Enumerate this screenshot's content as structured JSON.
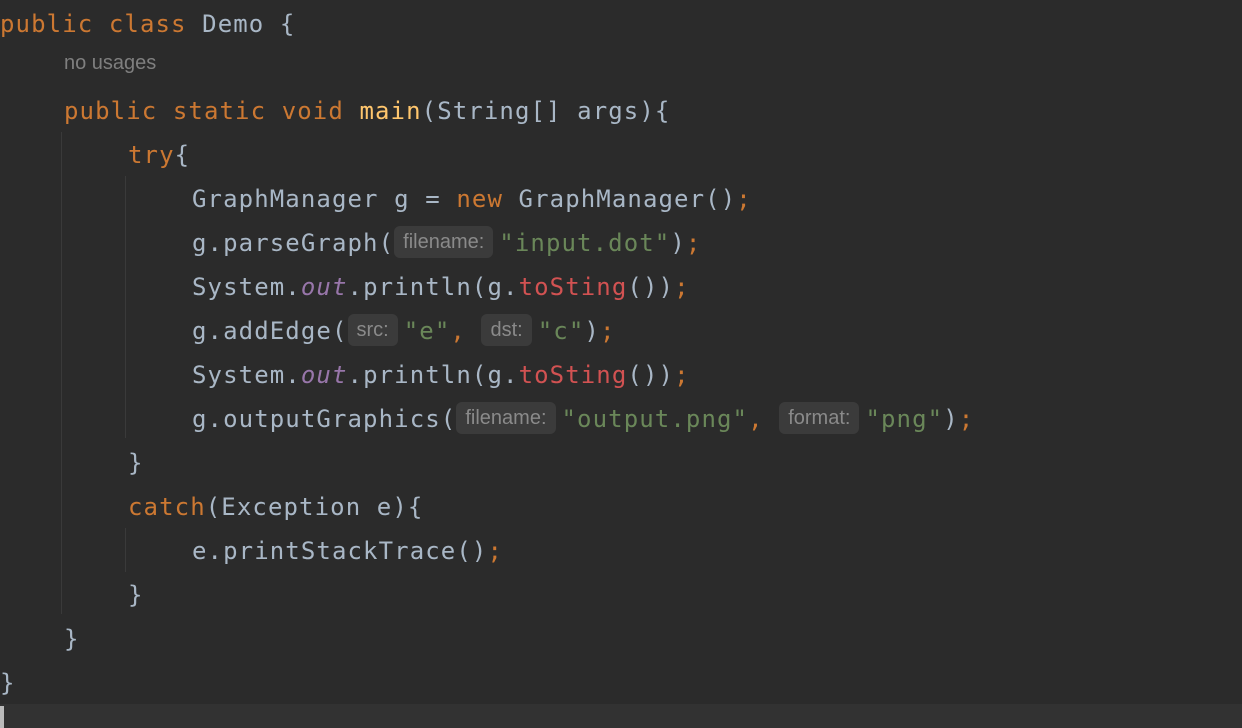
{
  "editor": {
    "language": "Java",
    "class_decl": {
      "kw": "public class",
      "name": "Demo",
      "brace": "{"
    },
    "usages_hint": "no usages",
    "main_decl": {
      "kw": "public static void",
      "name": "main",
      "params": "(String[] args){"
    },
    "try_kw": "try",
    "lines": {
      "l1": {
        "a": "GraphManager g = ",
        "kw": "new",
        "b": " GraphManager()",
        "semi": ";"
      },
      "l2": {
        "a": "g.parseGraph(",
        "hint": "filename:",
        "str": "\"input.dot\"",
        "b": ")",
        "semi": ";"
      },
      "l3": {
        "a": "System.",
        "field": "out",
        "b": ".println(g.",
        "err": "toSting",
        "c": "())",
        "semi": ";"
      },
      "l4": {
        "a": "g.addEdge(",
        "hint1": "src:",
        "str1": "\"e\"",
        "comma": ", ",
        "hint2": "dst:",
        "str2": "\"c\"",
        "b": ")",
        "semi": ";"
      },
      "l5": {
        "a": "System.",
        "field": "out",
        "b": ".println(g.",
        "err": "toSting",
        "c": "())",
        "semi": ";"
      },
      "l6": {
        "a": "g.outputGraphics(",
        "hint1": "filename:",
        "str1": "\"output.png\"",
        "comma": ", ",
        "hint2": "format:",
        "str2": "\"png\"",
        "b": ")",
        "semi": ";"
      }
    },
    "close_try": "}",
    "catch_kw": "catch",
    "catch_params": "(Exception e){",
    "catch_body": {
      "a": "e.printStackTrace()",
      "semi": ";"
    },
    "close_catch": "}",
    "close_main": "}",
    "close_class": "}"
  }
}
